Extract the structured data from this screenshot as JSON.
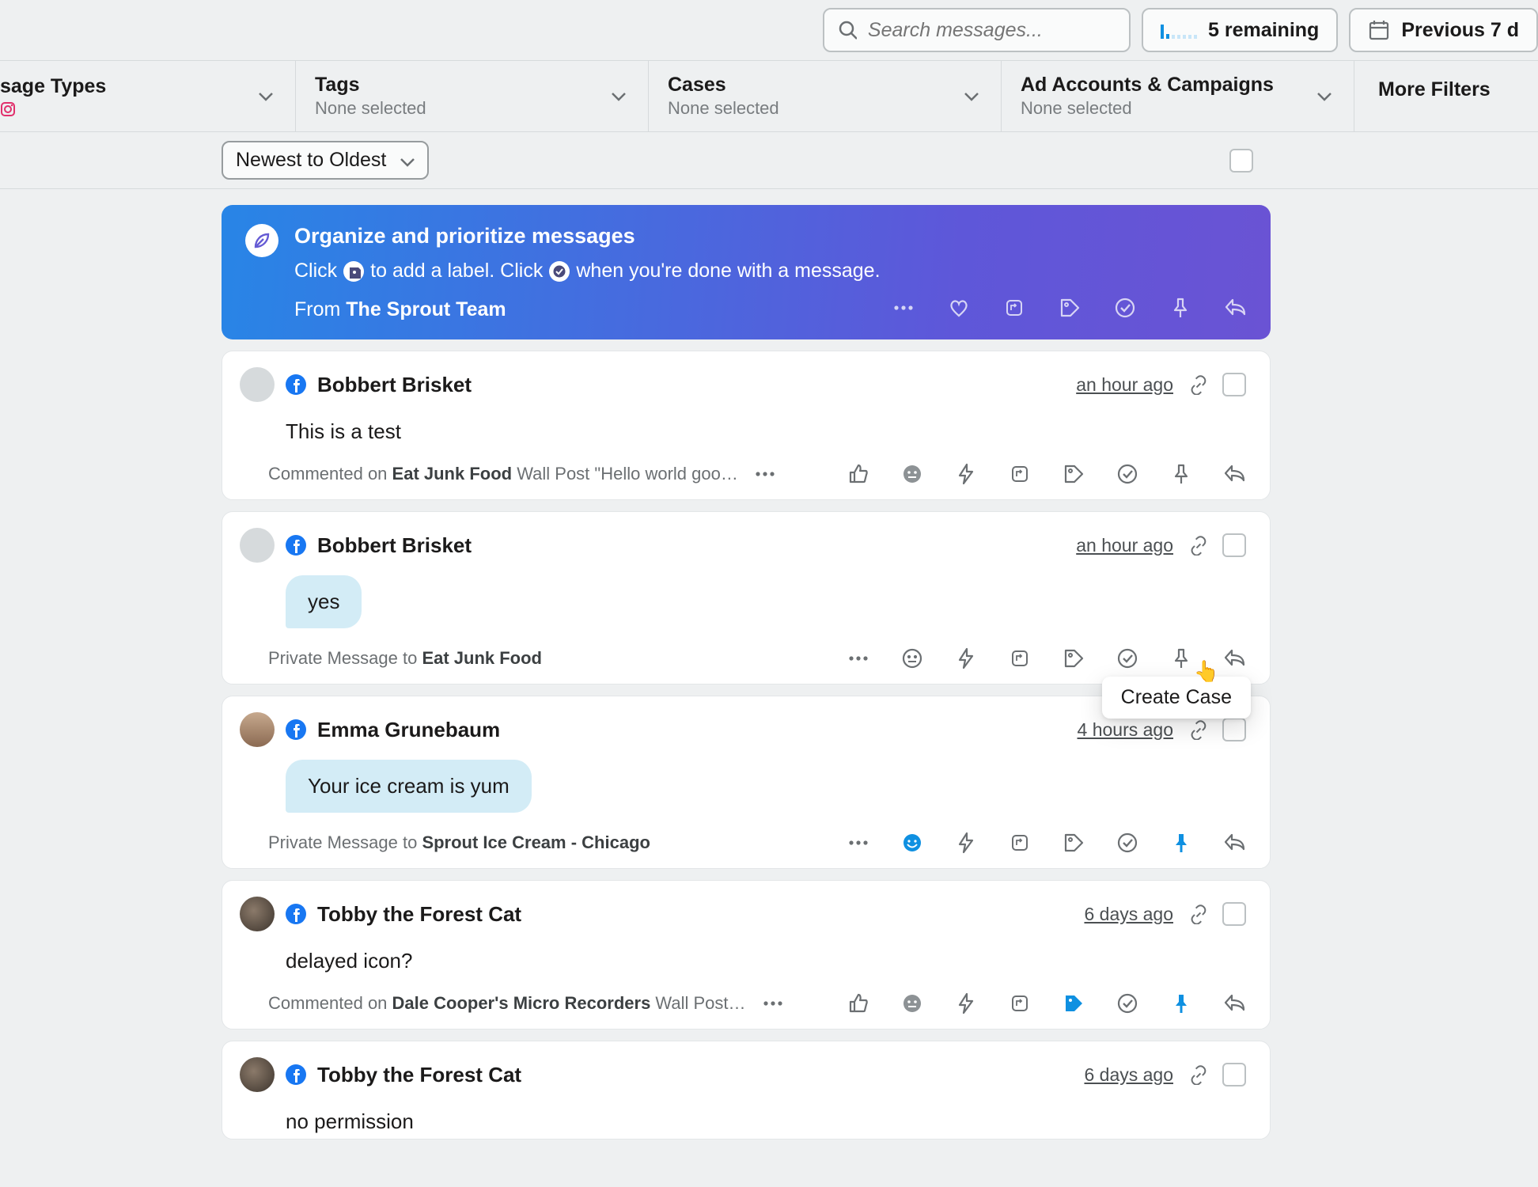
{
  "top": {
    "search_placeholder": "Search messages...",
    "remaining": "5 remaining",
    "date_range": "Previous 7 d"
  },
  "filters": {
    "types": {
      "label": "sage Types"
    },
    "tags": {
      "label": "Tags",
      "sub": "None selected"
    },
    "cases": {
      "label": "Cases",
      "sub": "None selected"
    },
    "ads": {
      "label": "Ad Accounts & Campaigns",
      "sub": "None selected"
    },
    "more": "More Filters"
  },
  "sort": {
    "label": "Newest to Oldest"
  },
  "banner": {
    "title": "Organize and prioritize messages",
    "tip_a": "Click",
    "tip_b": "to add a label. Click",
    "tip_c": "when you're done with a message.",
    "from_label": "From",
    "from_name": "The Sprout Team"
  },
  "tooltip": "Create Case",
  "messages": [
    {
      "author": "Bobbert Brisket",
      "time": "an hour ago",
      "body": "This is a test",
      "type": "comment",
      "context_pre": "Commented on ",
      "context_b": "Eat Junk Food",
      "context_post": " Wall Post \"Hello world goo…"
    },
    {
      "author": "Bobbert Brisket",
      "time": "an hour ago",
      "bubble": "yes",
      "type": "pm",
      "context_pre": "Private Message to ",
      "context_b": "Eat Junk Food",
      "context_post": "",
      "tooltip": true
    },
    {
      "author": "Emma Grunebaum",
      "time": "4 hours ago",
      "bubble": "Your ice cream is yum",
      "type": "pm",
      "context_pre": "Private Message to ",
      "context_b": "Sprout Ice Cream - Chicago",
      "context_post": "",
      "pinned": true,
      "emoji_blue": true,
      "avatar_variant": "person"
    },
    {
      "author": "Tobby the Forest Cat",
      "time": "6 days ago",
      "body": "delayed icon?",
      "type": "comment",
      "context_pre": "Commented on ",
      "context_b": "Dale Cooper's Micro Recorders",
      "context_post": " Wall Post…",
      "pinned": true,
      "tag_blue": true,
      "avatar_variant": "cat"
    },
    {
      "author": "Tobby the Forest Cat",
      "time": "6 days ago",
      "body": "no permission",
      "type": "partial",
      "avatar_variant": "cat"
    }
  ]
}
